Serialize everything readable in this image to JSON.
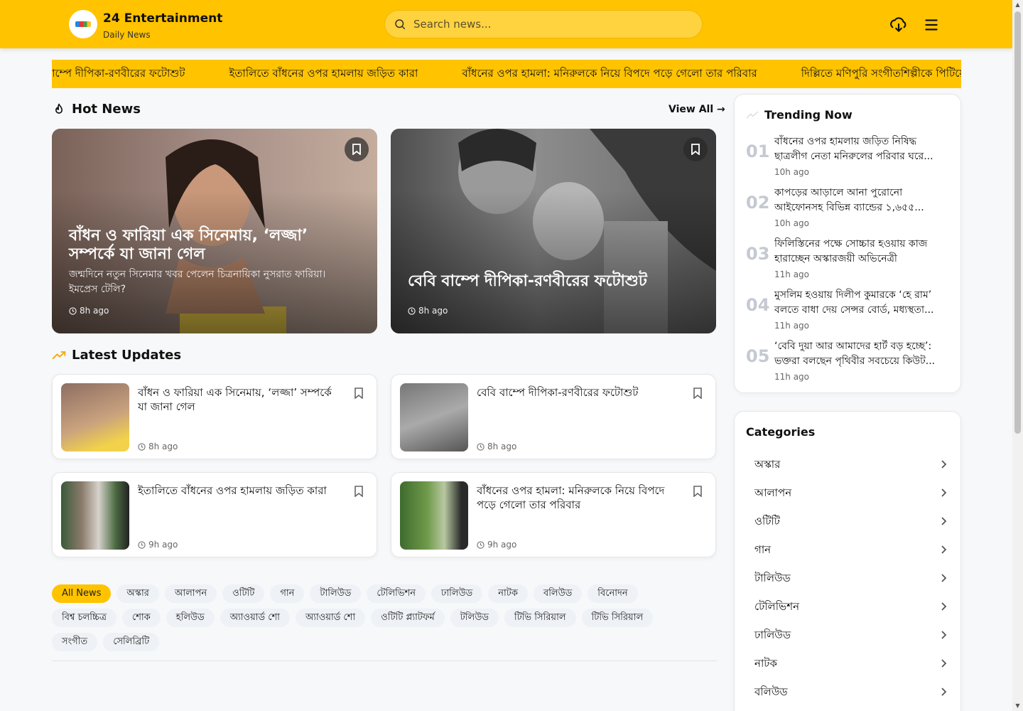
{
  "header": {
    "site_title": "24 Entertainment",
    "site_subtitle": "Daily News",
    "search_placeholder": "Search news..."
  },
  "ticker": {
    "items": [
      "বেবি বাম্পে দীপিকা-রণবীরের ফটোশুট",
      "ইতালিতে বাঁধনের ওপর হামলায় জড়িত কারা",
      "বাঁধনের ওপর হামলা: মনিরুলকে নিয়ে বিপদে পড়ে গেলো তার পরিবার",
      "দিল্লিতে মণিপুরি সংগীতশিল্পীকে পিটিয়ে হত্যা"
    ]
  },
  "hot_news": {
    "heading": "Hot News",
    "view_all": "View All →",
    "cards": [
      {
        "title": "বাঁধন ও ফারিয়া এক সিনেমায়, ‘লজ্জা’ সম্পর্কে যা জানা গেল",
        "desc": "জন্মদিনে নতুন সিনেমার খবর পেলেন চিত্রনায়িকা নুসরাত ফারিয়া। ইমপ্রেস টেলি?",
        "time": "8h ago"
      },
      {
        "title": "বেবি বাম্পে দীপিকা-রণবীরের ফটোশুট",
        "desc": "",
        "time": "8h ago"
      }
    ]
  },
  "latest": {
    "heading": "Latest Updates",
    "items": [
      {
        "title": "বাঁধন ও ফারিয়া এক সিনেমায়, ‘লজ্জা’ সম্পর্কে যা জানা গেল",
        "time": "8h ago"
      },
      {
        "title": "বেবি বাম্পে দীপিকা-রণবীরের ফটোশুট",
        "time": "8h ago"
      },
      {
        "title": "ইতালিতে বাঁধনের ওপর হামলায় জড়িত কারা",
        "time": "9h ago"
      },
      {
        "title": "বাঁধনের ওপর হামলা: মনিরুলকে নিয়ে বিপদে পড়ে গেলো তার পরিবার",
        "time": "9h ago"
      }
    ]
  },
  "chips": {
    "row1": [
      "All News",
      "অস্কার",
      "আলাপন",
      "ওটিটি",
      "গান",
      "টালিউড",
      "টেলিভিশন",
      "ঢালিউড",
      "নাটক",
      "বলিউড",
      "বিনোদন"
    ],
    "row2": [
      "বিশ্ব চলচ্চিত্র",
      "শোক",
      "হলিউড",
      "অ্যাওয়ার্ড শো",
      "অ্যাওয়ার্ড শো",
      "ওটিটি প্ল্যাটফর্ম",
      "টলিউড",
      "টিভি সিরিয়াল",
      "টিভি সিরিয়াল"
    ],
    "row3": [
      "সংগীত",
      "সেলিব্রিটি"
    ]
  },
  "trending": {
    "heading": "Trending Now",
    "items": [
      {
        "num": "01",
        "title": "বাঁধনের ওপর হামলায় জড়িত নিষিদ্ধ ছাত্রলীগ নেতা মনিরুলের পরিবার ঘরে...",
        "time": "10h ago"
      },
      {
        "num": "02",
        "title": "কাপড়ের আড়ালে আনা পুরোনো আইফোনসহ বিভিন্ন ব্যান্ডের ১,৬৫৫...",
        "time": "10h ago"
      },
      {
        "num": "03",
        "title": "ফিলিস্তিনের পক্ষে সোচ্চার হওয়ায় কাজ হারাচ্ছেন অস্কারজয়ী অভিনেত্রী",
        "time": "11h ago"
      },
      {
        "num": "04",
        "title": "মুসলিম হওয়ায় দিলীপ কুমারকে ‘হে রাম’ বলতে বাধা দেয় সেন্সর বোর্ড, মধ্যস্থতা...",
        "time": "11h ago"
      },
      {
        "num": "05",
        "title": "‘বেবি দুয়া আর আমাদের হার্ট বড় হচ্ছে’: ভক্তরা বলছেন পৃথিবীর সবচেয়ে কিউট...",
        "time": "11h ago"
      }
    ]
  },
  "categories": {
    "heading": "Categories",
    "items": [
      "অস্কার",
      "আলাপন",
      "ওটিটি",
      "গান",
      "টালিউড",
      "টেলিভিশন",
      "ঢালিউড",
      "নাটক",
      "বলিউড"
    ]
  },
  "colors": {
    "accent": "#ffc300",
    "chip_bg": "#eef1f5",
    "trend_num": "#c4c9d2"
  }
}
